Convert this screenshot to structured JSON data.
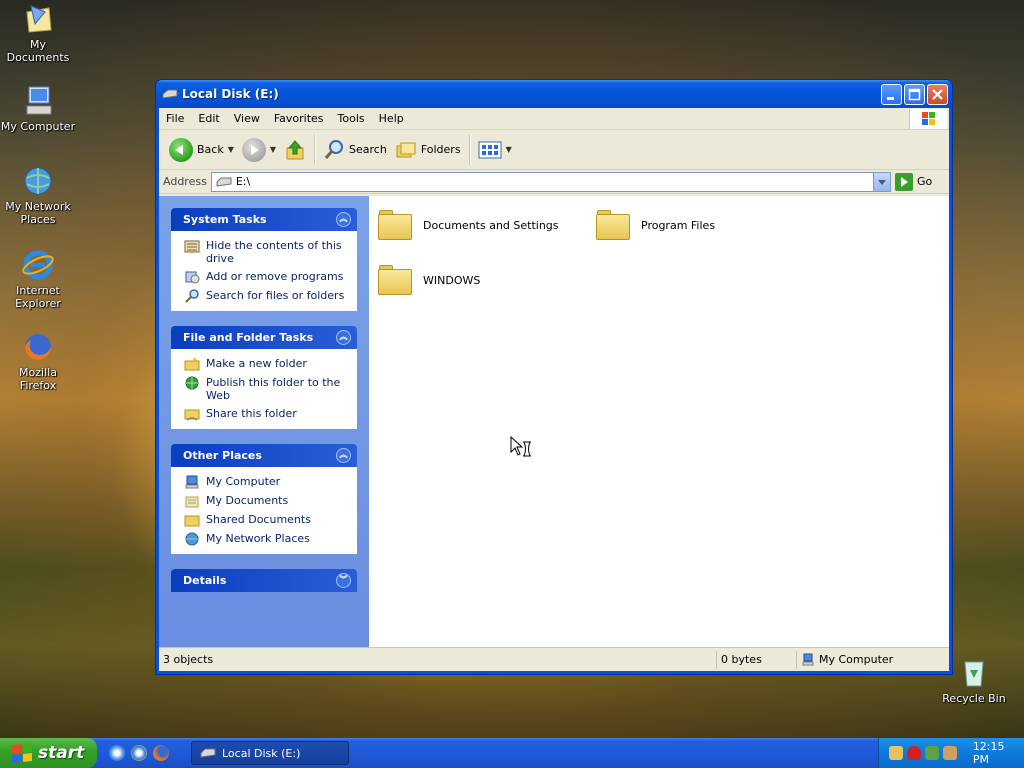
{
  "desktop": {
    "icons": [
      {
        "label": "My Documents",
        "icon": "my-documents-icon"
      },
      {
        "label": "My Computer",
        "icon": "my-computer-icon"
      },
      {
        "label": "My Network Places",
        "icon": "network-places-icon"
      },
      {
        "label": "Internet Explorer",
        "icon": "internet-explorer-icon"
      },
      {
        "label": "Mozilla Firefox",
        "icon": "firefox-icon"
      },
      {
        "label": "Recycle Bin",
        "icon": "recycle-bin-icon"
      }
    ]
  },
  "window": {
    "title": "Local Disk (E:)",
    "menu": [
      "File",
      "Edit",
      "View",
      "Favorites",
      "Tools",
      "Help"
    ],
    "toolbar": {
      "back": "Back",
      "search": "Search",
      "folders": "Folders"
    },
    "address": {
      "label": "Address",
      "value": "E:\\",
      "go": "Go"
    },
    "panels": [
      {
        "title": "System Tasks",
        "tasks": [
          "Hide the contents of this drive",
          "Add or remove programs",
          "Search for files or folders"
        ]
      },
      {
        "title": "File and Folder Tasks",
        "tasks": [
          "Make a new folder",
          "Publish this folder to the Web",
          "Share this folder"
        ]
      },
      {
        "title": "Other Places",
        "tasks": [
          "My Computer",
          "My Documents",
          "Shared Documents",
          "My Network Places"
        ]
      },
      {
        "title": "Details",
        "tasks": []
      }
    ],
    "items": [
      "Documents and Settings",
      "Program Files",
      "WINDOWS"
    ],
    "status": {
      "count": "3 objects",
      "size": "0 bytes",
      "location": "My Computer"
    }
  },
  "taskbar": {
    "start": "start",
    "task": "Local Disk (E:)",
    "clock": "12:15 PM"
  },
  "colors": {
    "titlebar": "#0654d8",
    "taskpane": "#7ba2e7",
    "start": "#36a228",
    "taskbar": "#245edc"
  }
}
